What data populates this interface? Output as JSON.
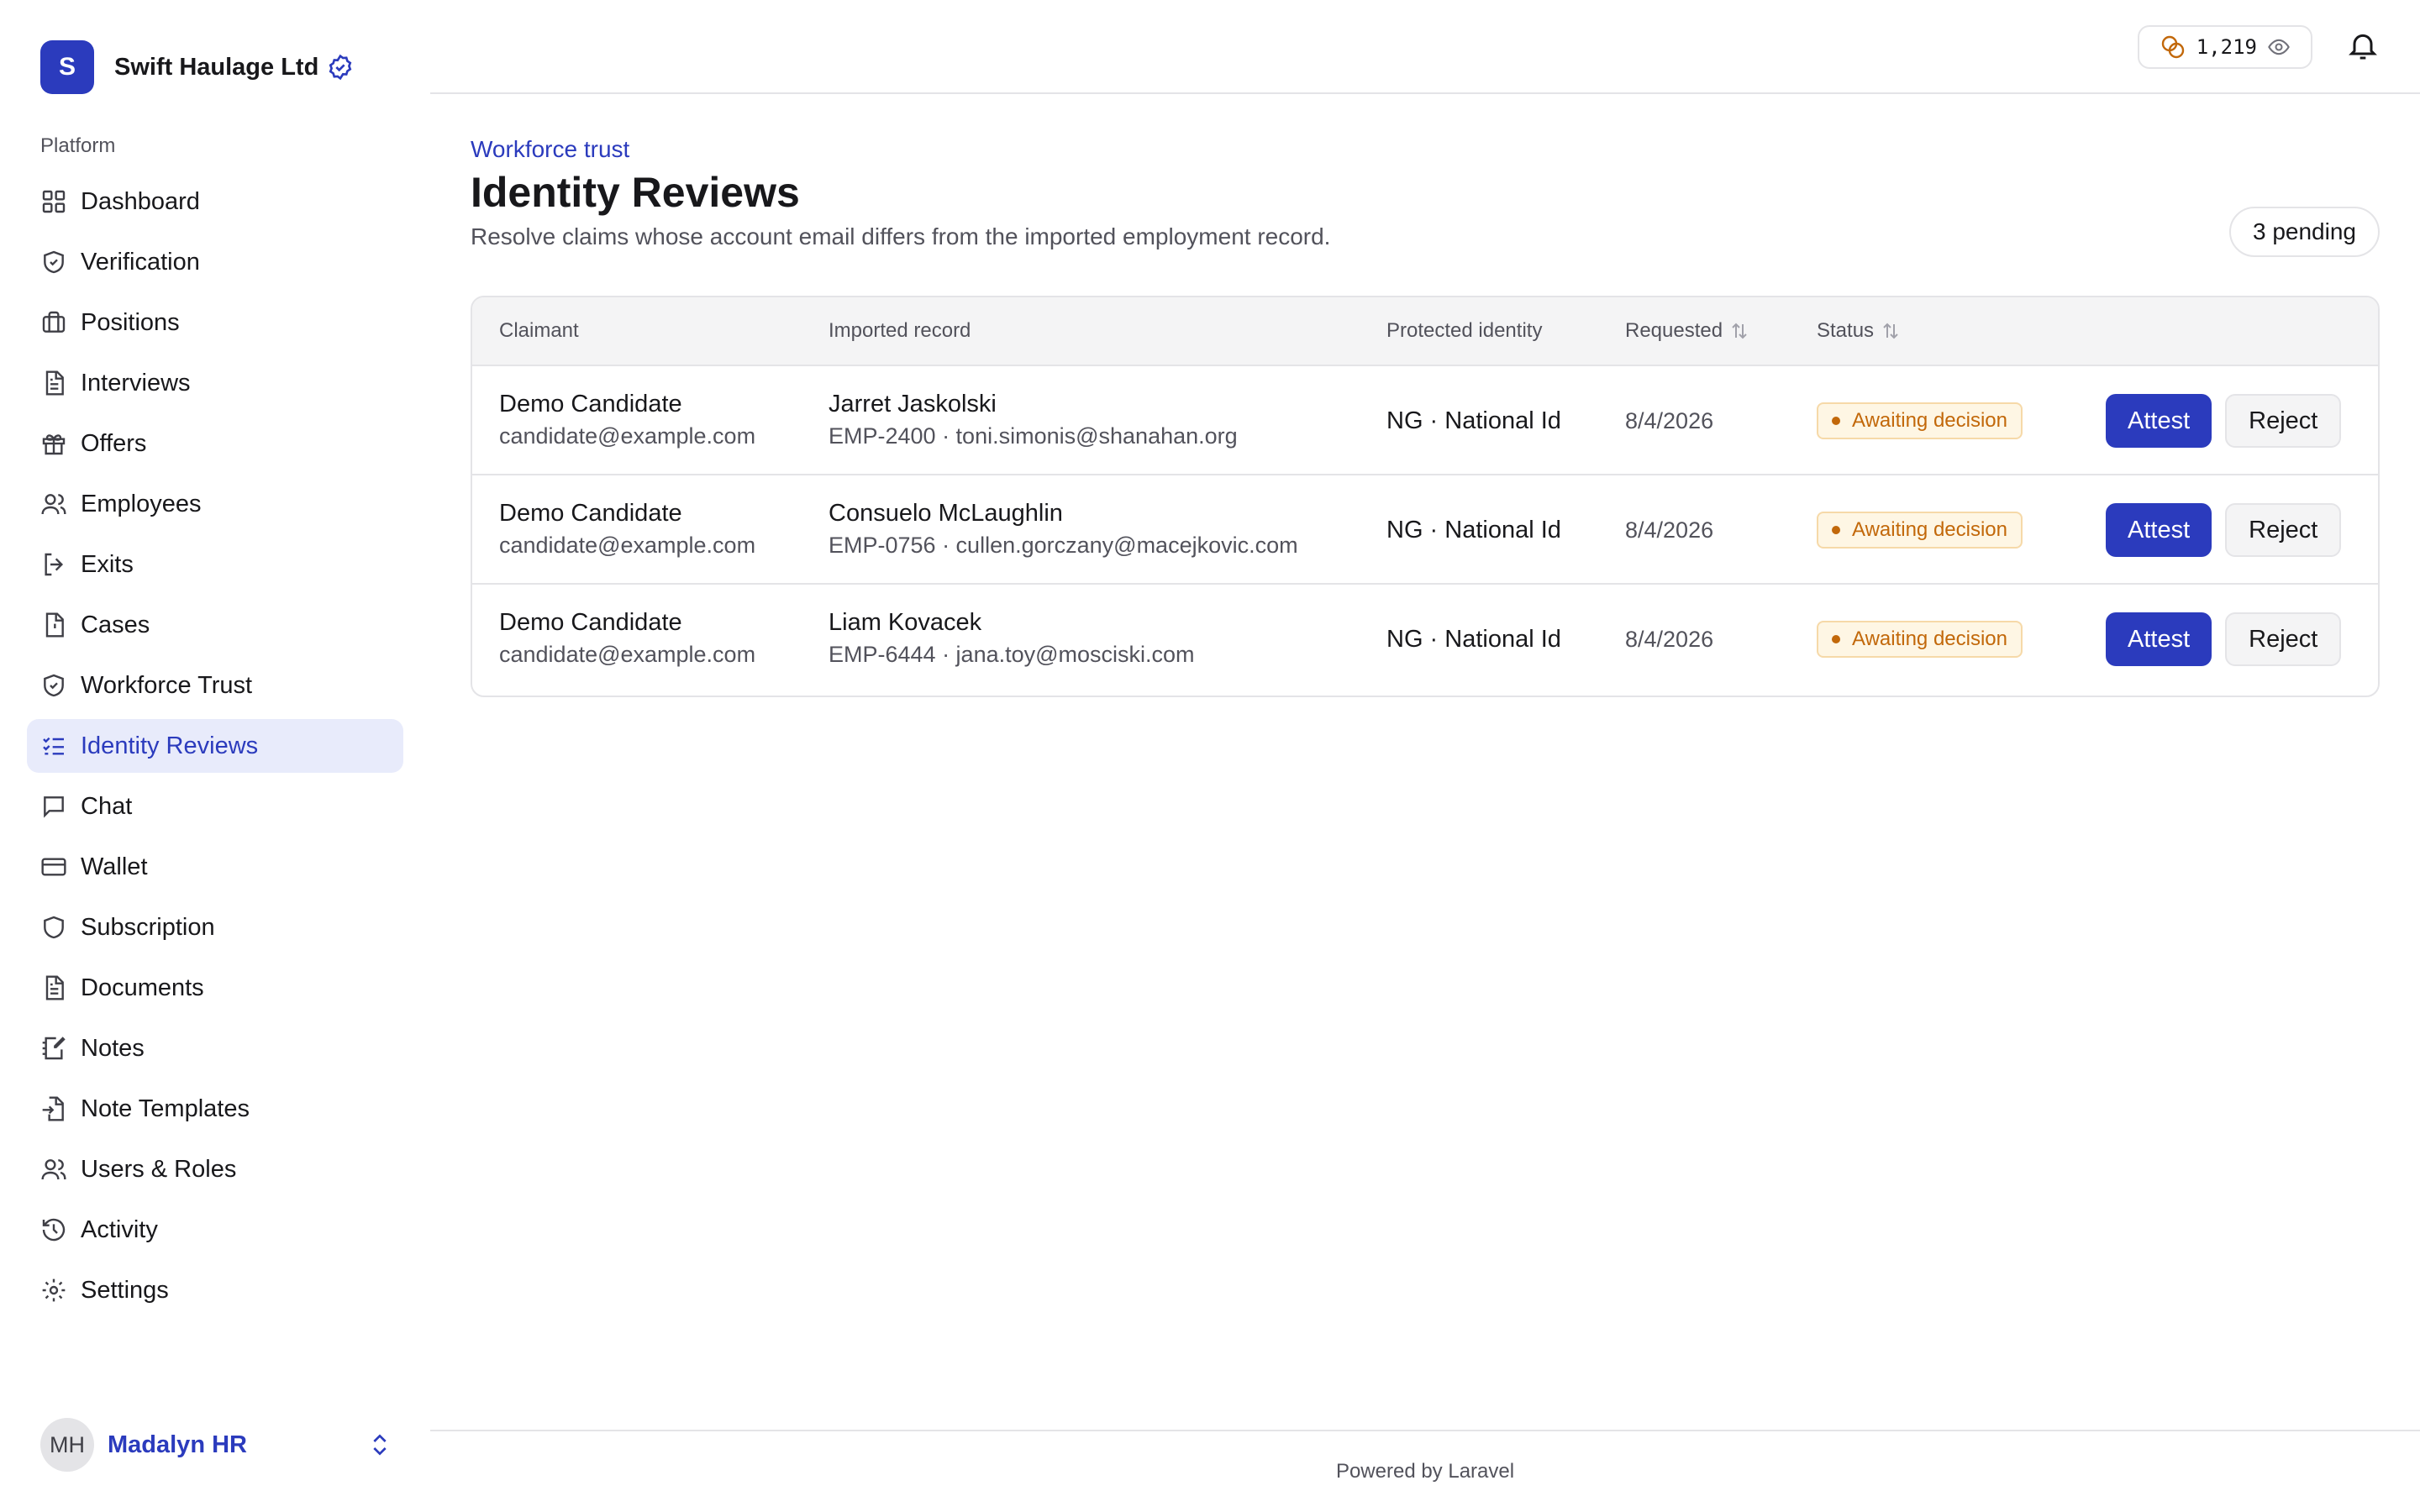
{
  "brand": {
    "initial": "S",
    "name": "Swift Haulage Ltd"
  },
  "sidebar": {
    "section_label": "Platform",
    "items": [
      {
        "label": "Dashboard",
        "icon": "grid-icon"
      },
      {
        "label": "Verification",
        "icon": "shield-check-icon"
      },
      {
        "label": "Positions",
        "icon": "briefcase-icon"
      },
      {
        "label": "Interviews",
        "icon": "document-icon"
      },
      {
        "label": "Offers",
        "icon": "gift-icon"
      },
      {
        "label": "Employees",
        "icon": "users-icon"
      },
      {
        "label": "Exits",
        "icon": "logout-icon"
      },
      {
        "label": "Cases",
        "icon": "file-alert-icon"
      },
      {
        "label": "Workforce Trust",
        "icon": "shield-check-icon"
      },
      {
        "label": "Identity Reviews",
        "icon": "list-check-icon",
        "active": true
      },
      {
        "label": "Chat",
        "icon": "chat-icon"
      },
      {
        "label": "Wallet",
        "icon": "credit-card-icon"
      },
      {
        "label": "Subscription",
        "icon": "shield-icon"
      },
      {
        "label": "Documents",
        "icon": "document-icon"
      },
      {
        "label": "Notes",
        "icon": "notebook-pen-icon"
      },
      {
        "label": "Note Templates",
        "icon": "file-import-icon"
      },
      {
        "label": "Users & Roles",
        "icon": "users-icon"
      },
      {
        "label": "Activity",
        "icon": "history-icon"
      },
      {
        "label": "Settings",
        "icon": "gear-icon"
      }
    ]
  },
  "user": {
    "initials": "MH",
    "name": "Madalyn HR"
  },
  "topbar": {
    "credits": "1,219"
  },
  "page": {
    "eyebrow": "Workforce trust",
    "title": "Identity Reviews",
    "description": "Resolve claims whose account email differs from the imported employment record.",
    "pending": "3 pending"
  },
  "table": {
    "headers": {
      "claimant": "Claimant",
      "imported": "Imported record",
      "protected": "Protected identity",
      "requested": "Requested",
      "status": "Status"
    },
    "rows": [
      {
        "claimant_name": "Demo Candidate",
        "claimant_email": "candidate@example.com",
        "record_name": "Jarret Jaskolski",
        "record_detail": "EMP-2400 · toni.simonis@shanahan.org",
        "protected": "NG · National Id",
        "requested": "8/4/2026",
        "status": "Awaiting decision",
        "attest": "Attest",
        "reject": "Reject"
      },
      {
        "claimant_name": "Demo Candidate",
        "claimant_email": "candidate@example.com",
        "record_name": "Consuelo McLaughlin",
        "record_detail": "EMP-0756 · cullen.gorczany@macejkovic.com",
        "protected": "NG · National Id",
        "requested": "8/4/2026",
        "status": "Awaiting decision",
        "attest": "Attest",
        "reject": "Reject"
      },
      {
        "claimant_name": "Demo Candidate",
        "claimant_email": "candidate@example.com",
        "record_name": "Liam Kovacek",
        "record_detail": "EMP-6444 · jana.toy@mosciski.com",
        "protected": "NG · National Id",
        "requested": "8/4/2026",
        "status": "Awaiting decision",
        "attest": "Attest",
        "reject": "Reject"
      }
    ]
  },
  "footer": {
    "text": "Powered by Laravel"
  },
  "colors": {
    "accent": "#2b3bbd",
    "warning": "#c2680a",
    "border": "#e4e4e7"
  }
}
